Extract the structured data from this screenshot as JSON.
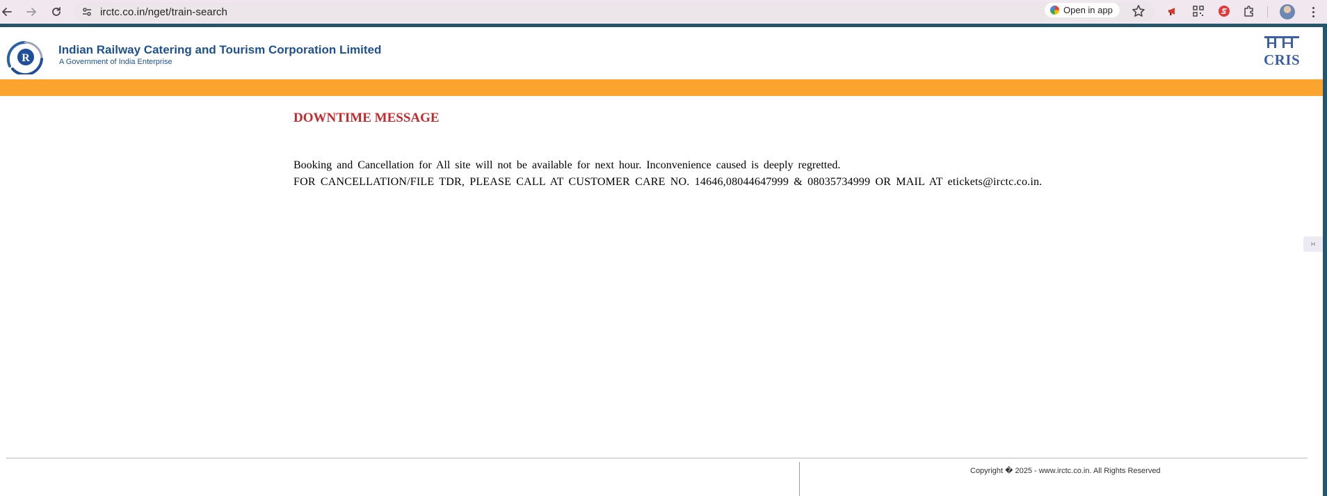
{
  "browser": {
    "url": "irctc.co.in/nget/train-search",
    "open_in_app_label": "Open in app"
  },
  "header": {
    "org_name": "Indian Railway Catering and Tourism Corporation Limited",
    "org_subtitle": "A Government of India Enterprise",
    "partner_logo_text": "CRIS"
  },
  "content": {
    "title": "DOWNTIME MESSAGE",
    "line1": "Booking and Cancellation for All site will not be available for next hour. Inconvenience caused is deeply regretted.",
    "line2": "FOR CANCELLATION/FILE TDR, PLEASE CALL AT CUSTOMER CARE NO. 14646,08044647999 & 08035734999 OR MAIL AT etickets@irctc.co.in."
  },
  "footer": {
    "copyright": "Copyright � 2025 - www.irctc.co.in. All Rights Reserved"
  },
  "colors": {
    "brand_blue": "#1e5190",
    "frame_teal": "#25566d",
    "orange_band": "#fba52e",
    "title_red": "#c9272a"
  },
  "icons": [
    "back-arrow-icon",
    "forward-arrow-icon",
    "reload-icon",
    "site-settings-icon",
    "star-icon",
    "megaphone-icon",
    "qr-code-icon",
    "extension-red-icon",
    "puzzle-icon",
    "profile-avatar",
    "more-menu-icon",
    "irctc-logo",
    "cris-logo",
    "side-panel-icon"
  ]
}
